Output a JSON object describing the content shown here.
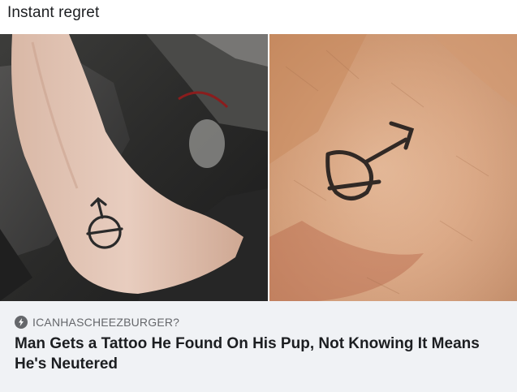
{
  "post": {
    "text": "Instant regret"
  },
  "images": {
    "left_alt": "Man's forearm with neutered-male symbol tattoo",
    "right_alt": "Dog's skin with neutered-male symbol tattoo",
    "icon": "photo"
  },
  "link_preview": {
    "source_icon": "bolt-icon",
    "source": "ICANHASCHEEZBURGER?",
    "headline": "Man Gets a Tattoo He Found On His Pup, Not Knowing It Means He's Neutered"
  }
}
